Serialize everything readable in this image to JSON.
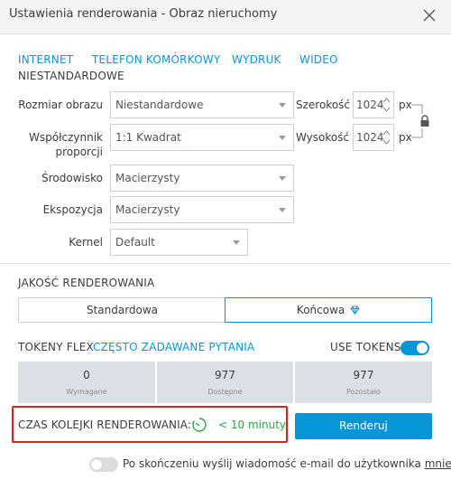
{
  "window": {
    "title": "Ustawienia renderowania - Obraz nieruchomy"
  },
  "tabs": [
    "INTERNET",
    "TELEFON KOMÓRKOWY",
    "WYDRUK",
    "WIDEO"
  ],
  "subtab": "NIESTANDARDOWE",
  "form": {
    "image_size_label": "Rozmiar obrazu",
    "image_size_value": "Niestandardowe",
    "aspect_label_line1": "Współczynnik",
    "aspect_label_line2": "proporcji",
    "aspect_value": "1:1 Kwadrat",
    "environment_label": "Środowisko",
    "environment_value": "Macierzysty",
    "exposure_label": "Ekspozycja",
    "exposure_value": "Macierzysty",
    "kernel_label": "Kernel",
    "kernel_value": "Default",
    "width_label": "Szerokość",
    "width_value": "1024",
    "height_label": "Wysokość",
    "height_value": "1024",
    "unit": "px"
  },
  "quality": {
    "heading": "JAKOŚĆ RENDEROWANIA",
    "options": [
      "Standardowa",
      "Końcowa"
    ],
    "selected": "Końcowa"
  },
  "tokens": {
    "heading": "TOKENY FLEX",
    "faq_link": "CZĘSTO ZADAWANE PYTANIA",
    "use_tokens_label": "USE TOKENS",
    "use_tokens_on": true,
    "stats": [
      {
        "value": "0",
        "label": "Wymagane"
      },
      {
        "value": "977",
        "label": "Dostępne"
      },
      {
        "value": "977",
        "label": "Pozostało"
      }
    ]
  },
  "queue": {
    "label": "CZAS KOLEJKI RENDEROWANIA:",
    "time": "< 10 minuty"
  },
  "render_button": "Renderuj",
  "email": {
    "prefix": "Po skończeniu wyślij wiadomość e-mail do użytkownika",
    "link": "mnie",
    "on": false
  },
  "colors": {
    "accent": "#0696d7",
    "green": "#28a745",
    "highlight": "#e41e1e",
    "stat_bg": "#dce0e4"
  }
}
